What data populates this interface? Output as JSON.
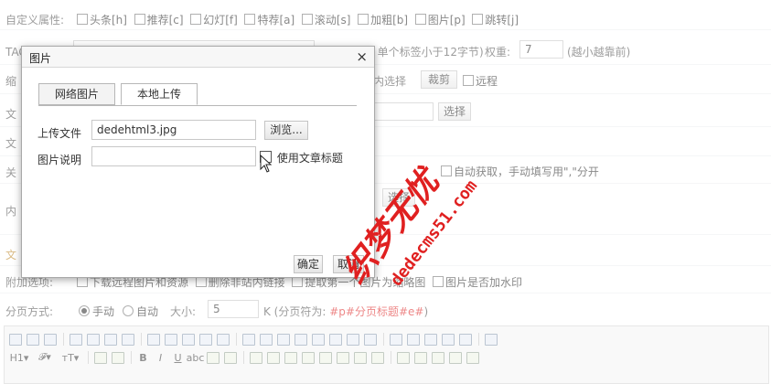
{
  "form": {
    "attr_label": "自定义属性:",
    "attrs": [
      "头条[h]",
      "推荐[c]",
      "幻灯[f]",
      "特荐[a]",
      "滚动[s]",
      "加粗[b]",
      "图片[p]",
      "跳转[j]"
    ],
    "tag_label": "TAG标签:",
    "tag_hint": "(逗号分开，单个标签小于12字节)",
    "weight_label": "权重:",
    "weight_value": "7",
    "weight_hint": "(越小越靠前)",
    "thumb_label": "缩",
    "inner_select_btn": "内选择",
    "crop_btn": "裁剪",
    "remote_label": "远程",
    "article_label_1": "文",
    "article_label_2": "文",
    "select_btn": "选择",
    "keyword_label": "关",
    "keyword_hint": "自动获取，手动填写用\",\"分开",
    "content_label": "内",
    "select_btn2": "选择",
    "article_label_3": "文",
    "extra_label": "附加选项:",
    "extra_opts": [
      "下载远程图片和资源",
      "删除非站内链接",
      "提取第一个图片为缩略图",
      "图片是否加水印"
    ],
    "paging_label": "分页方式:",
    "paging_manual": "手动",
    "paging_auto": "自动",
    "size_label": "大小:",
    "size_value": "5",
    "paging_hint": "K (分页符为:",
    "paging_code": "#p#分页标题#e#",
    "paging_close": ")"
  },
  "dialog": {
    "title": "图片",
    "close": "×",
    "tabs": [
      "网络图片",
      "本地上传"
    ],
    "upload_label": "上传文件",
    "file_value": "dedehtml3.jpg",
    "browse_btn": "浏览...",
    "desc_label": "图片说明",
    "desc_value": "",
    "use_title_label": "使用文章标题",
    "ok_btn": "确定",
    "cancel_btn": "取消"
  },
  "toolbar": {
    "row1": [
      "源码",
      "撤销",
      "重做",
      "预览",
      "打印",
      "模板",
      "代码",
      "剪切",
      "复制",
      "粘贴",
      "纯文本",
      "Word",
      "左对齐",
      "居中",
      "右对齐",
      "两端",
      "编号",
      "项目",
      "缩进",
      "减少缩进",
      "下标",
      "上标",
      "格式刷",
      "全选",
      "清除",
      "全屏"
    ],
    "row2_dropdowns": [
      "H1",
      "𝓕",
      "тT"
    ],
    "row2": [
      "文字颜色",
      "背景色",
      "B",
      "I",
      "U",
      "ABC",
      "斜删",
      "清除",
      "图片",
      "Flash",
      "媒体",
      "表格",
      "文件",
      "插入",
      "表情",
      "插入横线",
      "锚点",
      "分页",
      "链接",
      "取消链接",
      "插入分页"
    ]
  },
  "watermark": {
    "text": "织梦无忧",
    "url": "dedecms51.com"
  },
  "colors": {
    "accent_red": "#e03030",
    "watermark_red": "#e02020"
  }
}
